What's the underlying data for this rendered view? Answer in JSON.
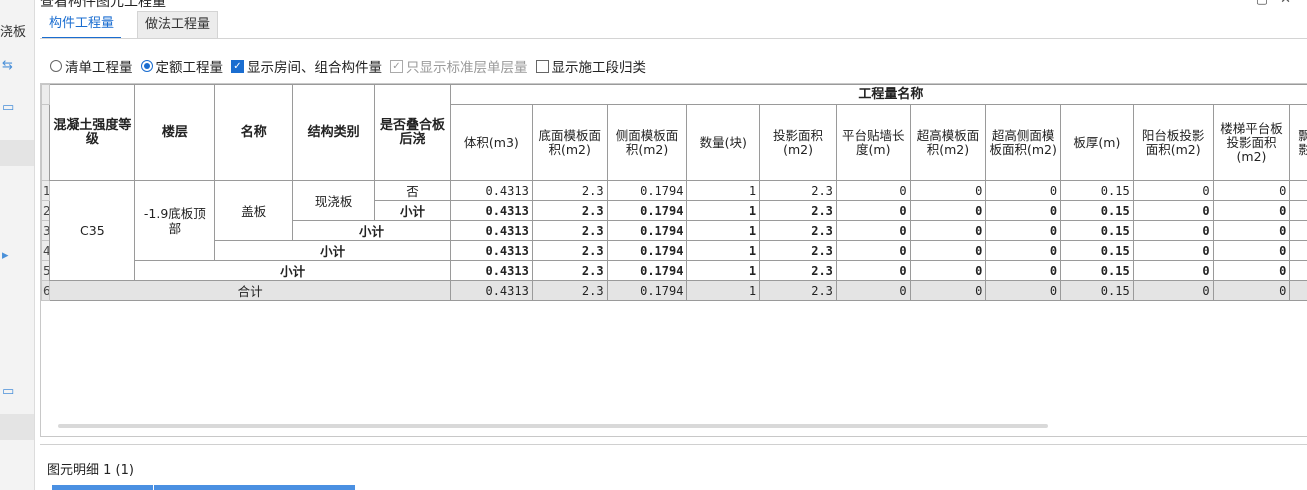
{
  "window": {
    "title": "查看构件图元工程量",
    "left_sidebar_label": "浇板"
  },
  "tabs": [
    {
      "label": "构件工程量",
      "active": true
    },
    {
      "label": "做法工程量",
      "active": false
    }
  ],
  "options": [
    {
      "type": "radio",
      "label": "清单工程量",
      "checked": false,
      "enabled": true
    },
    {
      "type": "radio",
      "label": "定额工程量",
      "checked": true,
      "enabled": true
    },
    {
      "type": "checkbox",
      "label": "显示房间、组合构件量",
      "checked": true,
      "enabled": true
    },
    {
      "type": "checkbox",
      "label": "只显示标准层单层量",
      "checked": true,
      "enabled": false
    },
    {
      "type": "checkbox",
      "label": "显示施工段归类",
      "checked": false,
      "enabled": true
    }
  ],
  "table": {
    "group_header": "工程量名称",
    "key_headers": [
      "混凝土强度等级",
      "楼层",
      "名称",
      "结构类别",
      "是否叠合板后浇"
    ],
    "value_headers": [
      "体积(m3)",
      "底面模板面积(m2)",
      "侧面模板面积(m2)",
      "数量(块)",
      "投影面积(m2)",
      "平台贴墙长度(m)",
      "超高模板面积(m2)",
      "超高侧面模板面积(m2)",
      "板厚(m)",
      "阳台板投影面积(m2)",
      "楼梯平台板投影面积(m2)",
      "飘窗影面"
    ],
    "row_numbers": [
      "1",
      "2",
      "3",
      "4",
      "5",
      "6"
    ],
    "cells": {
      "grade": "C35",
      "floor": "-1.9底板顶部",
      "name": "盖板",
      "struct_type": "现浇板",
      "is_composite": "否"
    },
    "subtotal_label": "小计",
    "total_label": "合计",
    "values": [
      "0.4313",
      "2.3",
      "0.1794",
      "1",
      "2.3",
      "0",
      "0",
      "0",
      "0.15",
      "0",
      "0"
    ]
  },
  "detail": {
    "title": "图元明细",
    "count_text": "1 (1)"
  }
}
